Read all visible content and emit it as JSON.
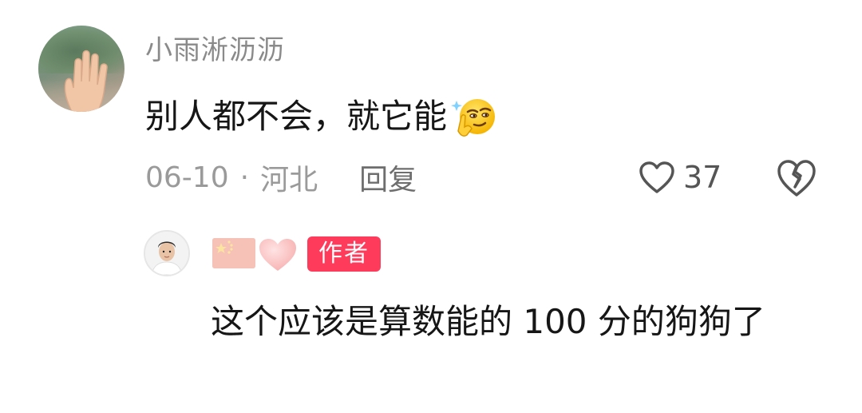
{
  "comment": {
    "username": "小雨淅沥沥",
    "text": "别人都不会，就它能",
    "emoji": "smug-thinking-face-emoji",
    "date": "06-10",
    "separator": "·",
    "location": "河北",
    "reply_label": "回复",
    "likes": "37",
    "icons": {
      "like": "heart-outline-icon",
      "dislike": "broken-heart-icon"
    }
  },
  "reply": {
    "avatar": "author-avatar",
    "flag": "china-flag-emoji",
    "heart": "pink-heart-emoji",
    "badge_label": "作者",
    "text": "这个应该是算数能的 100 分的狗狗了"
  },
  "colors": {
    "badge_bg": "#ff3b5c",
    "meta_text": "#9a9a9a",
    "username_text": "#8a8a8a",
    "body_text": "#161616"
  }
}
